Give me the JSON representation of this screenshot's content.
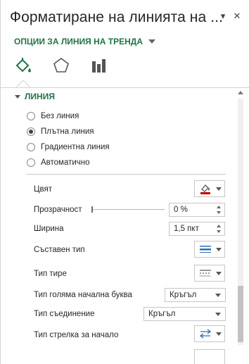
{
  "pane": {
    "title": "Форматиране на линията на ...",
    "minimize_glyph": "▾",
    "close_glyph": "✕"
  },
  "options_menu": {
    "label": "ОПЦИИ ЗА ЛИНИЯ НА ТРЕНДА"
  },
  "tabs": [
    {
      "name": "fill-line",
      "icon": "paint-bucket-icon",
      "active": true
    },
    {
      "name": "effects",
      "icon": "pentagon-icon",
      "active": false
    },
    {
      "name": "options",
      "icon": "bar-chart-icon",
      "active": false
    }
  ],
  "section": {
    "title": "ЛИНИЯ",
    "expanded": true
  },
  "line_type": {
    "options": [
      {
        "label": "Без линия",
        "selected": false
      },
      {
        "label": "Плътна линия",
        "selected": true
      },
      {
        "label": "Градиентна линия",
        "selected": false
      },
      {
        "label": "Автоматично",
        "selected": false
      }
    ]
  },
  "props": {
    "color_label": "Цвят",
    "color_value": "#c00000",
    "transparency_label": "Прозрачност",
    "transparency_value": "0 %",
    "transparency_level": 0,
    "width_label": "Ширина",
    "width_value": "1,5 пкт",
    "compound_label": "Съставен тип",
    "dash_label": "Тип тире",
    "cap_label": "Тип голяма начална буква",
    "cap_value": "Кръгъл",
    "join_label": "Тип съединение",
    "join_value": "Кръгъл",
    "arrow_begin_label": "Тип стрелка за начало"
  },
  "colors": {
    "accent_green": "#217346",
    "border": "#c6c6c6"
  }
}
